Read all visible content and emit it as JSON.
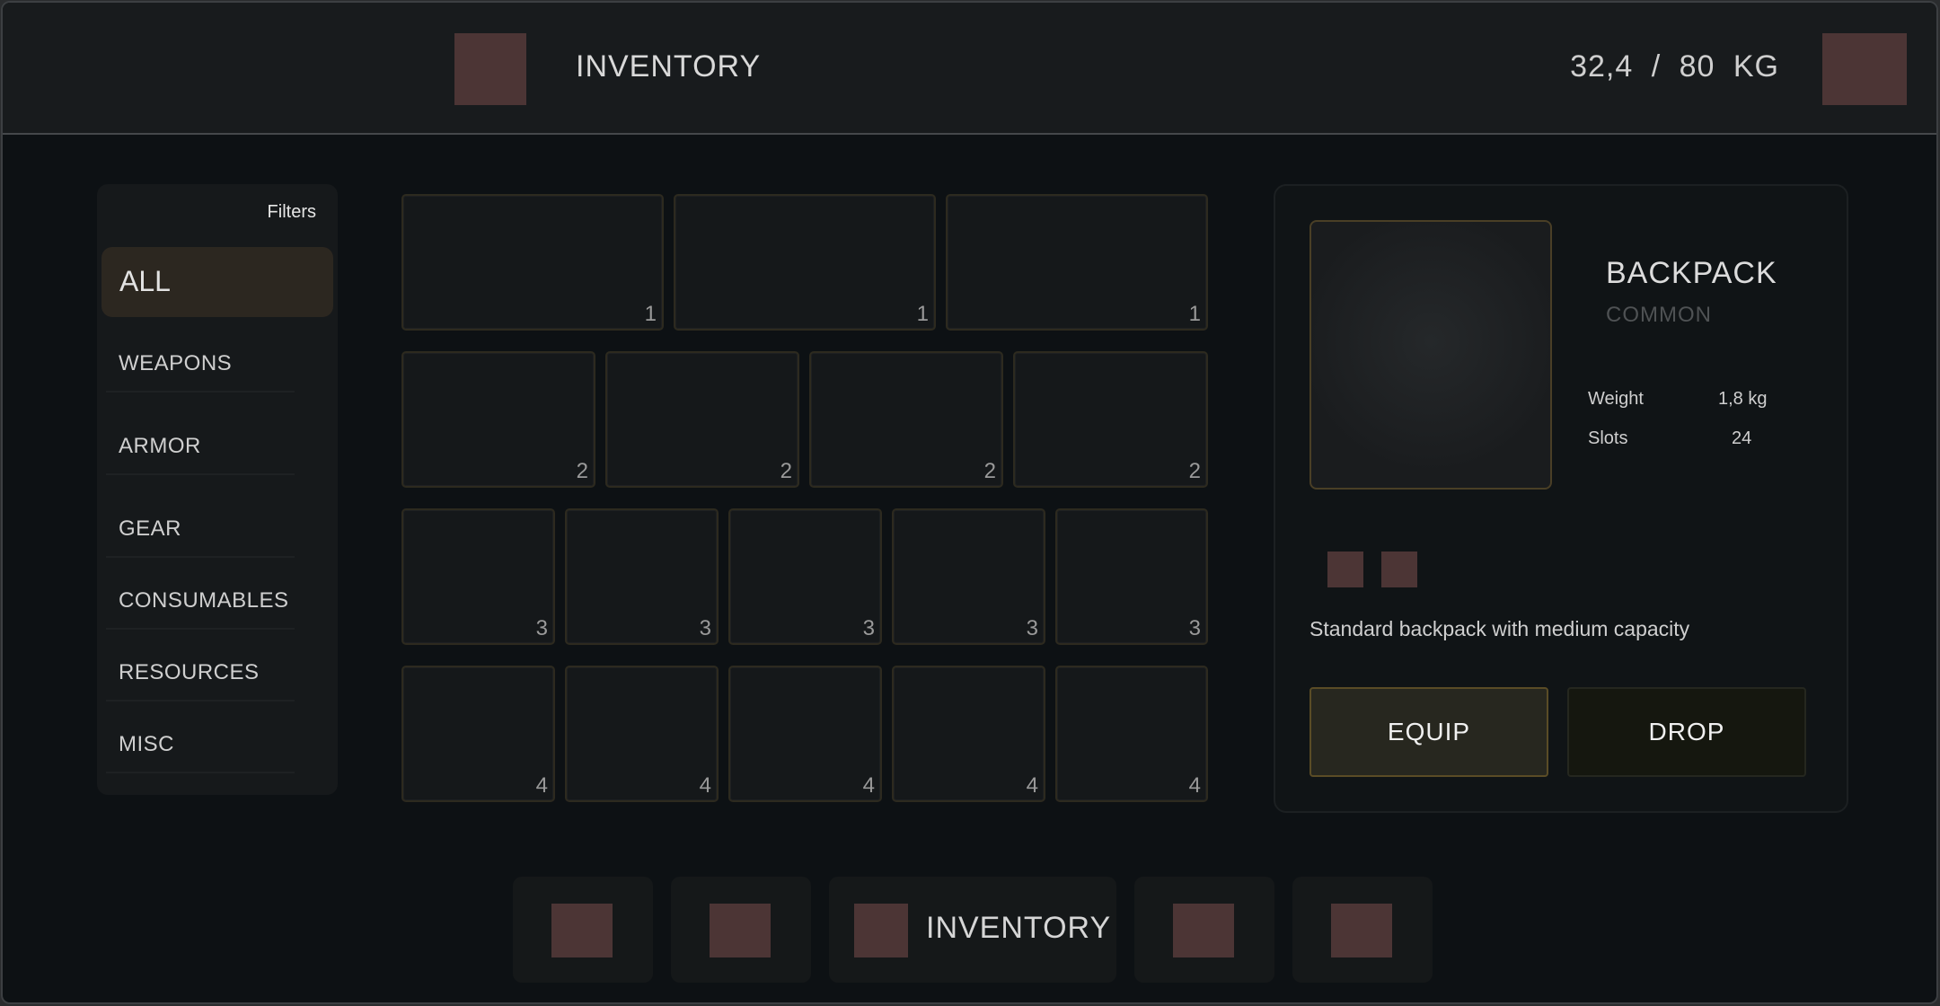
{
  "header": {
    "title": "INVENTORY",
    "weight": "32,4  /  80 KG",
    "menu_icon": "square-icon",
    "profile_icon": "square-icon"
  },
  "filters": {
    "title": "Filters",
    "active": "ALL",
    "items": [
      "WEAPONS",
      "ARMOR",
      "GEAR",
      "CONSUMABLES",
      "RESOURCES",
      "MISC"
    ]
  },
  "grid": {
    "rows": [
      {
        "counts": [
          "1",
          "1",
          "1"
        ]
      },
      {
        "counts": [
          "2",
          "2",
          "2",
          "2"
        ]
      },
      {
        "counts": [
          "3",
          "3",
          "3",
          "3",
          "3"
        ]
      },
      {
        "counts": [
          "4",
          "4",
          "4",
          "4",
          "4"
        ]
      }
    ]
  },
  "detail": {
    "name": "BACKPACK",
    "rarity": "COMMON",
    "stats": [
      {
        "label": "Weight",
        "value": "1,8 kg"
      },
      {
        "label": "Slots",
        "value": "24"
      }
    ],
    "description": "Standard backpack with medium capacity",
    "equip_label": "EQUIP",
    "drop_label": "DROP"
  },
  "bottom_nav": {
    "active_label": "INVENTORY"
  }
}
